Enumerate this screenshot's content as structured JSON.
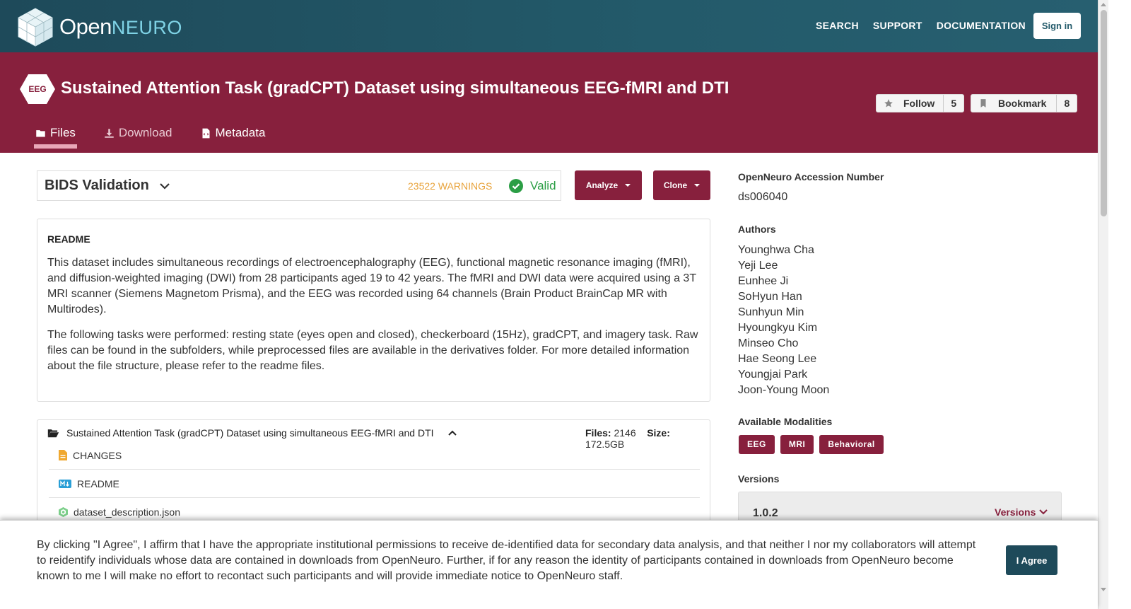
{
  "topnav": {
    "logo_open": "Open",
    "logo_neuro": "NEURO",
    "links": [
      "SEARCH",
      "SUPPORT",
      "DOCUMENTATION"
    ],
    "signin_label": "Sign in"
  },
  "dataset": {
    "modality_badge": "EEG",
    "title": "Sustained Attention Task (gradCPT) Dataset using simultaneous EEG-fMRI and DTI",
    "follow_label": "Follow",
    "follow_count": "5",
    "bookmark_label": "Bookmark",
    "bookmark_count": "8",
    "tabs": [
      {
        "label": "Files",
        "icon": "folder-icon",
        "active": true
      },
      {
        "label": "Download",
        "icon": "download-icon",
        "active": false
      },
      {
        "label": "Metadata",
        "icon": "file-code-icon",
        "active": false
      }
    ]
  },
  "validation": {
    "title": "BIDS Validation",
    "warnings": "23522 WARNINGS",
    "status": "Valid"
  },
  "actions": {
    "analyze_label": "Analyze",
    "clone_label": "Clone"
  },
  "readme": {
    "heading": "README",
    "paragraphs": [
      "This dataset includes simultaneous recordings of electroencephalography (EEG), functional magnetic resonance imaging (fMRI), and diffusion-weighted imaging (DWI) from 28 participants aged 19 to 42 years. The fMRI and DWI data were acquired using a 3T MRI scanner (Siemens Magnetom Prisma), and the EEG was recorded using 64 channels (Brain Product BrainCap MR with Multirodes).",
      "The following tasks were performed: resting state (eyes open and closed), checkerboard (15Hz), gradCPT, and imagery task. Raw files can be found in the subfolders, while preprocessed files are available in the derivatives folder. For more detailed information about the file structure, please refer to the readme files."
    ]
  },
  "filetree": {
    "root_name": "Sustained Attention Task (gradCPT) Dataset using simultaneous EEG-fMRI and DTI",
    "files_label": "Files:",
    "files_count": "2146",
    "size_label": "Size:",
    "size_value": "172.5GB",
    "files": [
      {
        "name": "CHANGES",
        "icon": "file-text-icon"
      },
      {
        "name": "README",
        "icon": "markdown-icon"
      },
      {
        "name": "dataset_description.json",
        "icon": "json-icon"
      }
    ]
  },
  "sidebar": {
    "accession_label": "OpenNeuro Accession Number",
    "accession": "ds006040",
    "authors_label": "Authors",
    "authors": [
      "Younghwa Cha",
      "Yeji Lee",
      "Eunhee Ji",
      "SoHyun Han",
      "Sunhyun Min",
      "Hyoungkyu Kim",
      "Minseo Cho",
      "Hae Seong Lee",
      "Youngjai Park",
      "Joon-Young Moon"
    ],
    "modalities_label": "Available Modalities",
    "modalities": [
      "EEG",
      "MRI",
      "Behavioral"
    ],
    "versions_label": "Versions",
    "version": "1.0.2",
    "versions_button": "Versions"
  },
  "consent": {
    "text": "By clicking \"I Agree\", I affirm that I have the appropriate institutional permissions to receive de-identified data for secondary data analysis, and that neither I nor my collaborators will attempt to reidentify individuals whose data are contained in downloads from OpenNeuro. Further, if for any reason the identity of participants contained in downloads from OpenNeuro become known to me I will make no effort to recontact such participants and will provide immediate notice to OpenNeuro staff.",
    "agree_label": "I Agree"
  },
  "colors": {
    "nav": "#235a6a",
    "header": "#87203d",
    "warning": "#e8a33b",
    "valid": "#2b9e45"
  }
}
